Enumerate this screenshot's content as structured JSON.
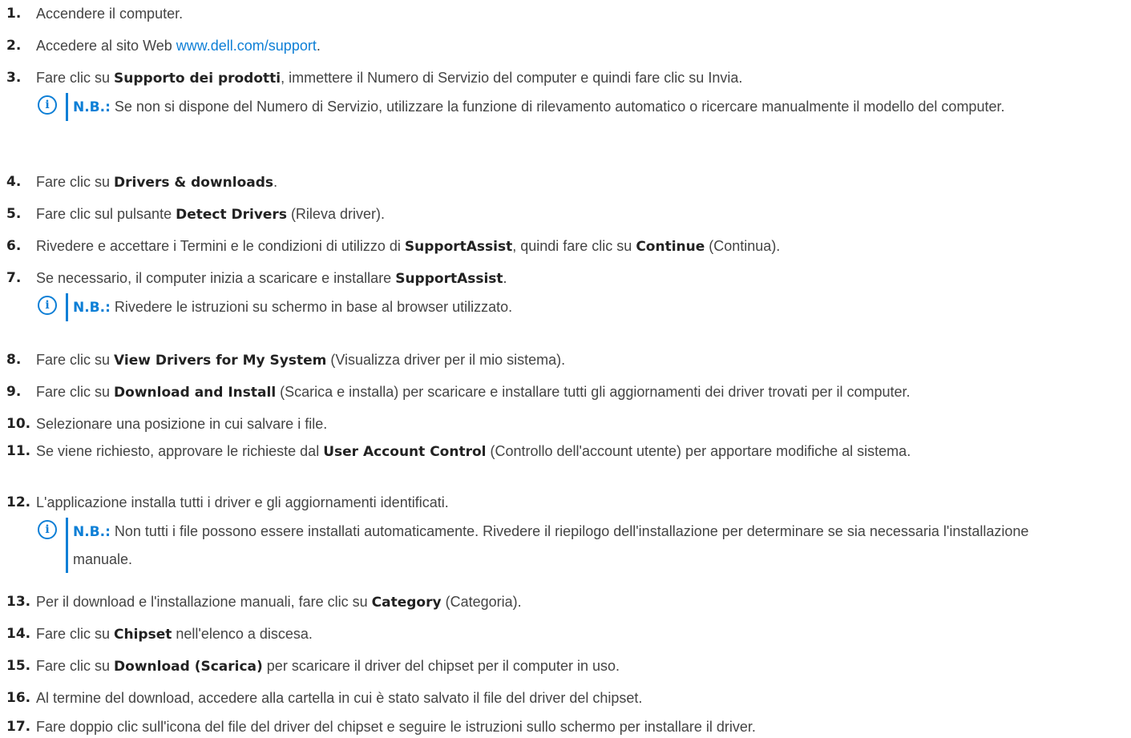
{
  "steps": [
    {
      "n": "1.",
      "text": "Accendere il computer."
    },
    {
      "n": "2.",
      "a": "Accedere al sito Web ",
      "link": "www.dell.com/support",
      "b": "."
    },
    {
      "n": "3.",
      "a": "Fare clic su ",
      "bold": "Supporto dei prodotti",
      "b": ", immettere il Numero di Servizio del computer e quindi fare clic su Invia."
    },
    {
      "n": "4.",
      "a": "Fare clic su ",
      "bold": "Drivers & downloads",
      "b": "."
    },
    {
      "n": "5.",
      "a": "Fare clic sul pulsante ",
      "bold": "Detect Drivers",
      "b": " (Rileva driver)."
    },
    {
      "n": "6.",
      "a": "Rivedere e accettare i Termini e le condizioni di utilizzo di ",
      "bold": "SupportAssist",
      "b": ", quindi fare clic su ",
      "bold2": "Continue",
      "c": " (Continua)."
    },
    {
      "n": "7.",
      "a": "Se necessario, il computer inizia a scaricare e installare ",
      "bold": "SupportAssist",
      "b": "."
    },
    {
      "n": "8.",
      "a": "Fare clic su ",
      "bold": "View Drivers for My System",
      "b": " (Visualizza driver per il mio sistema)."
    },
    {
      "n": "9.",
      "a": "Fare clic su ",
      "bold": "Download and Install",
      "b": " (Scarica e installa) per scaricare e installare tutti gli aggiornamenti dei driver trovati per il computer."
    },
    {
      "n": "10.",
      "text": "Selezionare una posizione in cui salvare i file."
    },
    {
      "n": "11.",
      "a": "Se viene richiesto, approvare le richieste dal ",
      "bold": "User Account Control",
      "b": " (Controllo dell'account utente) per apportare modifiche al sistema."
    },
    {
      "n": "12.",
      "text": "L'applicazione installa tutti i driver e gli aggiornamenti identificati."
    },
    {
      "n": "13.",
      "a": "Per il download e l'installazione manuali, fare clic su ",
      "bold": "Category",
      "b": " (Categoria)."
    },
    {
      "n": "14.",
      "a": "Fare clic su ",
      "bold": "Chipset",
      "b": " nell'elenco a discesa."
    },
    {
      "n": "15.",
      "a": "Fare clic su ",
      "bold": "Download (Scarica)",
      "b": " per scaricare il driver del chipset per il computer in uso."
    },
    {
      "n": "16.",
      "text": "Al termine del download, accedere alla cartella in cui è stato salvato il file del driver del chipset."
    },
    {
      "n": "17.",
      "text": "Fare doppio clic sull'icona del file del driver del chipset e seguire le istruzioni sullo schermo per installare il driver."
    }
  ],
  "notes": [
    {
      "label": "N.B.:",
      "text": " Se non si dispone del Numero di Servizio, utilizzare la funzione di rilevamento automatico o ricercare manualmente il modello del computer."
    },
    {
      "label": "N.B.:",
      "text": " Rivedere le istruzioni su schermo in base al browser utilizzato."
    },
    {
      "label": "N.B.:",
      "text": " Non tutti i file possono essere installati automaticamente. Rivedere il riepilogo dell'installazione per determinare se sia necessaria l'installazione manuale."
    }
  ],
  "icon_glyph": "i",
  "colors": {
    "accent": "#0d7fd6",
    "text": "#444444",
    "bold": "#222222"
  }
}
